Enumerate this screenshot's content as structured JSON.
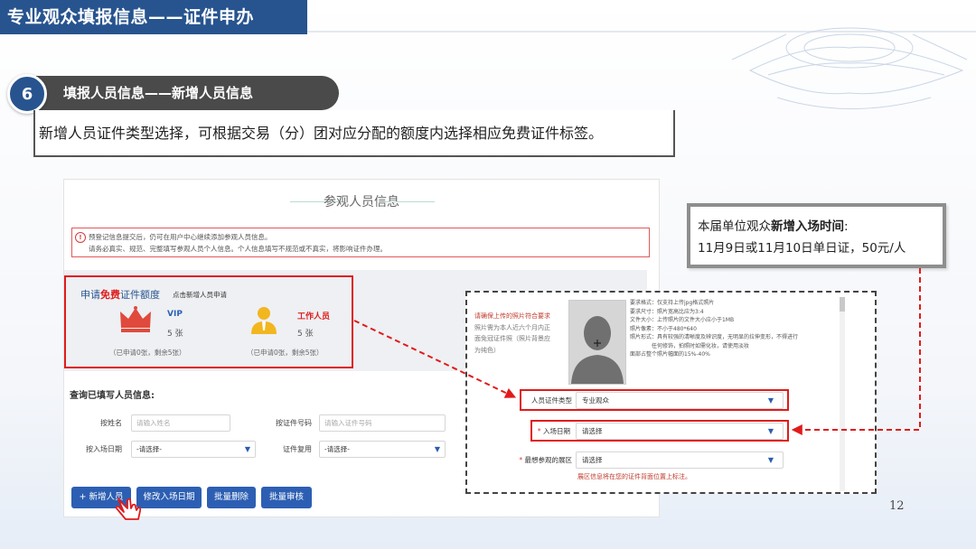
{
  "slide": {
    "title": "专业观众填报信息——证件申办",
    "step_number": "6",
    "step_title": "填报人员信息——新增人员信息",
    "description": "新增人员证件类型选择，可根据交易（分）团对应分配的额度内选择相应免费证件标签。",
    "page_number": "12"
  },
  "panel": {
    "title": "参观人员信息",
    "notice_line1": "预登记信息提交后，仍可在用户中心继续添加参观人员信息。",
    "notice_line2": "请务必真实、规范、完整填写参观人员个人信息。个人信息填写不规范或不真实，将影响证件办理。",
    "quota": {
      "title_prefix": "申请",
      "title_highlight": "免费",
      "title_suffix": "证件额度",
      "hint": "点击新增人员申请",
      "vip_label": "VIP",
      "vip_count": "5 张",
      "vip_sub": "（已申请0张，剩余5张）",
      "staff_label": "工作人员",
      "staff_count": "5 张",
      "staff_sub": "（已申请0张，剩余5张）"
    },
    "search": {
      "title": "查询已填写人员信息:",
      "name_label": "按姓名",
      "name_placeholder": "请输入姓名",
      "idno_label": "按证件号码",
      "idno_placeholder": "请输入证件号码",
      "date_label": "按入场日期",
      "date_value": "-请选择-",
      "reuse_label": "证件复用",
      "reuse_value": "-请选择-"
    },
    "buttons": {
      "add": "+ 新增人员",
      "change_date": "修改入场日期",
      "bulk_delete": "批量删除",
      "bulk_review": "批量审核"
    }
  },
  "popup": {
    "photo_warn_1": "请确保上传的照片符合要求",
    "photo_warn_2": "照片需为本人近六个月内正",
    "photo_warn_3": "面免冠证件照（照片背景应",
    "photo_warn_4": "为纯色）",
    "req_1": "要求格式：仅支持上传jpg格式照片",
    "req_2": "要求尺寸：照片宽高比应为3:4",
    "req_3": "文件大小：上传照片的文件大小应小于1MB",
    "req_4": "照片像素：不小于480*640",
    "req_5": "照片形式：具有较强的清晰度及辨识度，无明显的拉伸变形，不得进行",
    "req_6": "任何修饰，拍照时如需化妆，请使用淡妆",
    "req_7": "面部占整个照片幅面的15%-40%",
    "id_type_label": "人员证件类型",
    "id_type_value": "专业观众",
    "date_label": "入场日期",
    "date_value": "请选择",
    "area_label": "最想参观的展区",
    "area_value": "请选择",
    "area_note": "展区信息将在您的证件背面位置上标注。",
    "required_mark": "*"
  },
  "callout": {
    "line1_prefix": "本届单位观众",
    "line1_bold": "新增入场时间",
    "line1_suffix": ":",
    "line2": "11月9日或11月10日单日证，50元/人"
  },
  "colors": {
    "brand_blue": "#27548f",
    "highlight_red": "#e01b1b",
    "button_blue": "#2c5fb3"
  }
}
